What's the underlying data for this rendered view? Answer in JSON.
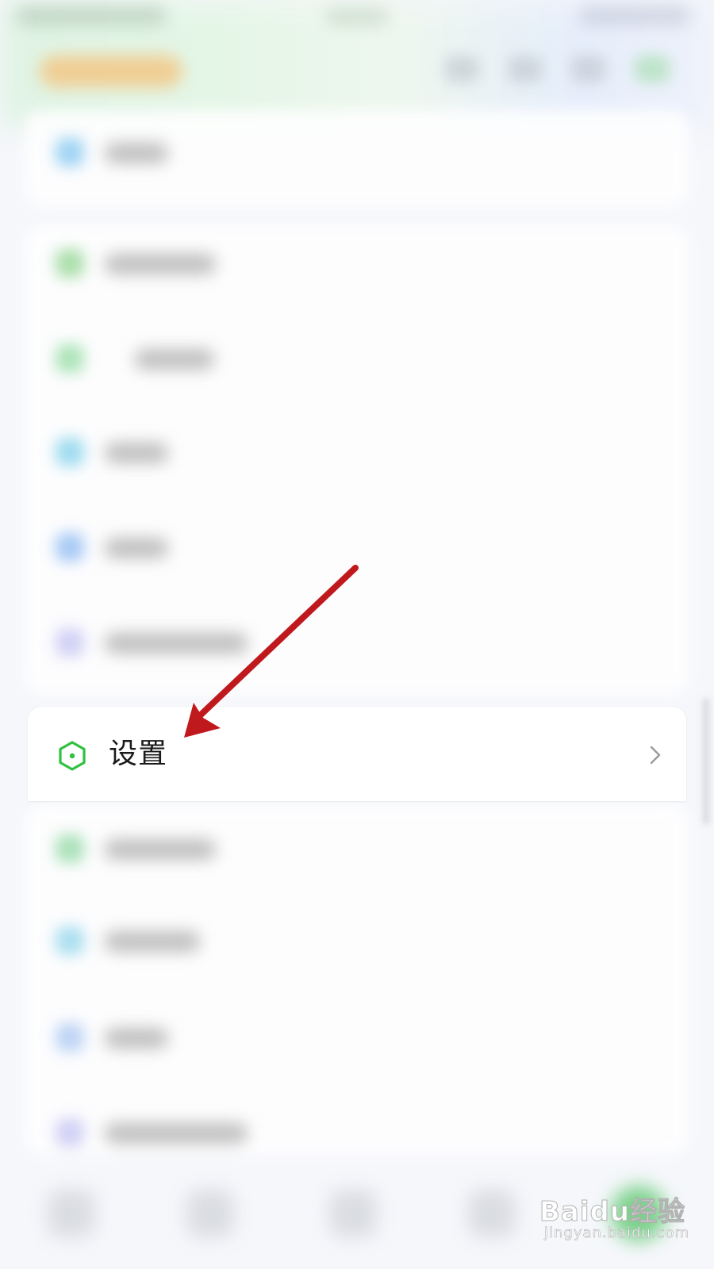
{
  "settings_row": {
    "label": "设置",
    "icon": "hexagon-settings-icon",
    "icon_color": "#2fc140",
    "chevron_icon": "chevron-right-icon",
    "chevron_color": "#9a9a9a"
  },
  "annotation": {
    "arrow_color": "#c0191d"
  },
  "watermark": {
    "brand": "Baidu经验",
    "url": "jingyan.baidu.com"
  }
}
